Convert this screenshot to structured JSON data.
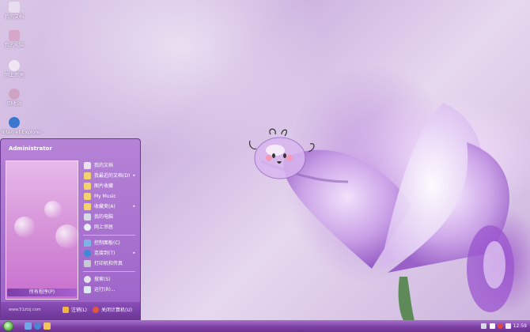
{
  "desktop": {
    "icons": [
      {
        "name": "my-documents",
        "label": "我的文档",
        "color": "#e7ddee"
      },
      {
        "name": "my-computer",
        "label": "我的电脑",
        "color": "#d7a7c9"
      },
      {
        "name": "network-places",
        "label": "网上邻居",
        "color": "#f0e6f3"
      },
      {
        "name": "recycle-bin",
        "label": "回收站",
        "color": "#cfa3c4"
      },
      {
        "name": "internet-explorer",
        "label": "Internet Explorer",
        "color": "#3c77cf"
      }
    ]
  },
  "start_menu": {
    "user_name": "Administrator",
    "all_programs_label": "所有程序(P)",
    "website": "www.51ztzj.com",
    "items_top": [
      {
        "label": "我的文档",
        "icon": "documents-icon",
        "color": "#e8e2ef",
        "arrow": ""
      },
      {
        "label": "我最近的文档(D)",
        "icon": "folder-icon",
        "color": "#f2d36e",
        "arrow": "▸"
      },
      {
        "label": "图片收藏",
        "icon": "pictures-icon",
        "color": "#f2d36e",
        "arrow": ""
      },
      {
        "label": "My Music",
        "icon": "music-icon",
        "color": "#f2d36e",
        "arrow": ""
      },
      {
        "label": "收藏夹(A)",
        "icon": "favorites-icon",
        "color": "#f2d36e",
        "arrow": "▸"
      },
      {
        "label": "我的电脑",
        "icon": "computer-icon",
        "color": "#d6d9e6",
        "arrow": ""
      },
      {
        "label": "网上邻居",
        "icon": "network-icon",
        "color": "#e9eef8",
        "arrow": ""
      }
    ],
    "items_mid": [
      {
        "label": "控制面板(C)",
        "icon": "control-panel-icon",
        "color": "#7fb3e8",
        "arrow": ""
      },
      {
        "label": "连接到(T)",
        "icon": "connect-icon",
        "color": "#3d8bd6",
        "arrow": "▸"
      },
      {
        "label": "打印机和传真",
        "icon": "printer-icon",
        "color": "#c9c9d6",
        "arrow": ""
      }
    ],
    "items_bottom": [
      {
        "label": "搜索(S)",
        "icon": "search-icon",
        "color": "#e3e3ea",
        "arrow": ""
      },
      {
        "label": "运行(R)...",
        "icon": "run-icon",
        "color": "#dfe7f2",
        "arrow": ""
      }
    ],
    "logoff_label": "注销(L)",
    "shutdown_label": "关闭计算机(U)"
  },
  "taskbar": {
    "clock": "12:59",
    "quick_launch": [
      {
        "name": "show-desktop-icon",
        "color": "#6fa8e6"
      },
      {
        "name": "ie-quicklaunch-icon",
        "color": "#4b86d4"
      },
      {
        "name": "media-quicklaunch-icon",
        "color": "#f0c65a"
      }
    ]
  }
}
